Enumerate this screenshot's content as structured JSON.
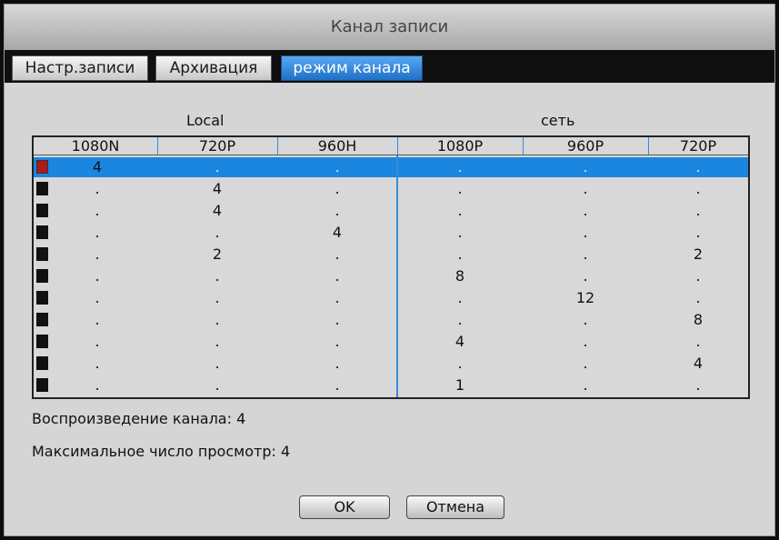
{
  "window": {
    "title": "Канал записи"
  },
  "tabs": [
    {
      "label": "Настр.записи",
      "active": false
    },
    {
      "label": "Архивация",
      "active": false
    },
    {
      "label": "режим канала",
      "active": true
    }
  ],
  "groups": {
    "local": "Local",
    "network": "сеть"
  },
  "table": {
    "headers": [
      "1080N",
      "720P",
      "960H",
      "1080P",
      "960P",
      "720P"
    ],
    "selected_row": 0,
    "rows": [
      [
        "4",
        ".",
        ".",
        ".",
        ".",
        "."
      ],
      [
        ".",
        "4",
        ".",
        ".",
        ".",
        "."
      ],
      [
        ".",
        "4",
        ".",
        ".",
        ".",
        "."
      ],
      [
        ".",
        ".",
        "4",
        ".",
        ".",
        "."
      ],
      [
        ".",
        "2",
        ".",
        ".",
        ".",
        "2"
      ],
      [
        ".",
        ".",
        ".",
        "8",
        ".",
        "."
      ],
      [
        ".",
        ".",
        ".",
        ".",
        "12",
        "."
      ],
      [
        ".",
        ".",
        ".",
        ".",
        ".",
        "8"
      ],
      [
        ".",
        ".",
        ".",
        "4",
        ".",
        "."
      ],
      [
        ".",
        ".",
        ".",
        ".",
        ".",
        "4"
      ],
      [
        ".",
        ".",
        ".",
        "1",
        ".",
        "."
      ]
    ]
  },
  "info": {
    "playback": "Воспроизведение канала: 4",
    "max_view": "Максимальное число просмотр: 4"
  },
  "buttons": {
    "ok": "OK",
    "cancel": "Отмена"
  },
  "colors": {
    "accent": "#1a86e0",
    "selected_check": "#b01818"
  }
}
